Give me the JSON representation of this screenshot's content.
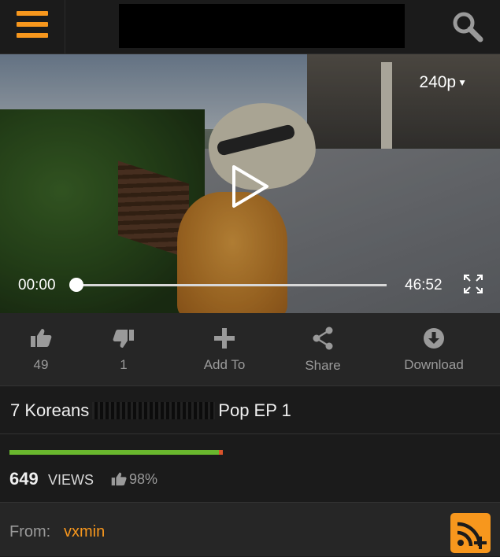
{
  "header": {
    "menu_icon": "hamburger-menu-icon",
    "search_icon": "search-icon",
    "accent_color": "#f7971d"
  },
  "player": {
    "quality": "240p",
    "current_time": "00:00",
    "duration": "46:52",
    "progress": 0,
    "play_icon": "play-icon",
    "fullscreen_icon": "fullscreen-icon"
  },
  "actions": {
    "likes": "49",
    "dislikes": "1",
    "add_to": "Add To",
    "share": "Share",
    "download": "Download"
  },
  "video": {
    "title_start": "7 Koreans",
    "title_end": "Pop EP 1"
  },
  "stats": {
    "views_count": "649",
    "views_label": "VIEWS",
    "rating": "98%",
    "rating_positive_fraction": 0.98,
    "positive_color": "#6ab72e",
    "negative_color": "#d9532b"
  },
  "uploader": {
    "from_label": "From:",
    "username": "vxmin",
    "subscribe_icon": "rss-add-icon"
  }
}
